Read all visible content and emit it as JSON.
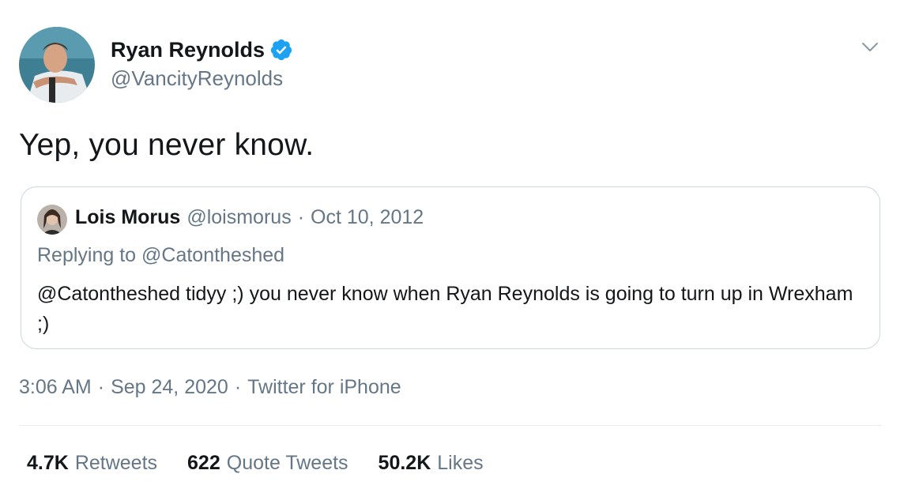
{
  "tweet": {
    "author_name": "Ryan Reynolds",
    "author_handle": "@VancityReynolds",
    "text": "Yep, you never know.",
    "time": "3:06 AM",
    "date": "Sep 24, 2020",
    "source": "Twitter for iPhone",
    "separator": "·"
  },
  "quoted_tweet": {
    "author_name": "Lois Morus",
    "author_handle": "@loismorus",
    "separator": "·",
    "date": "Oct 10, 2012",
    "replying_to": "Replying to @Catontheshed",
    "text": "@Catontheshed tidyy ;) you never know when Ryan Reynolds is going to turn up in Wrexham ;)"
  },
  "stats": {
    "retweets": {
      "count": "4.7K",
      "label": "Retweets"
    },
    "quote_tweets": {
      "count": "622",
      "label": "Quote Tweets"
    },
    "likes": {
      "count": "50.2K",
      "label": "Likes"
    }
  },
  "colors": {
    "verified": "#1da1f2",
    "secondary_text": "#657786",
    "primary_text": "#14171a",
    "border": "#ccd6dd"
  },
  "icons": {
    "verified": "verified-badge-icon",
    "more": "chevron-down-icon"
  }
}
